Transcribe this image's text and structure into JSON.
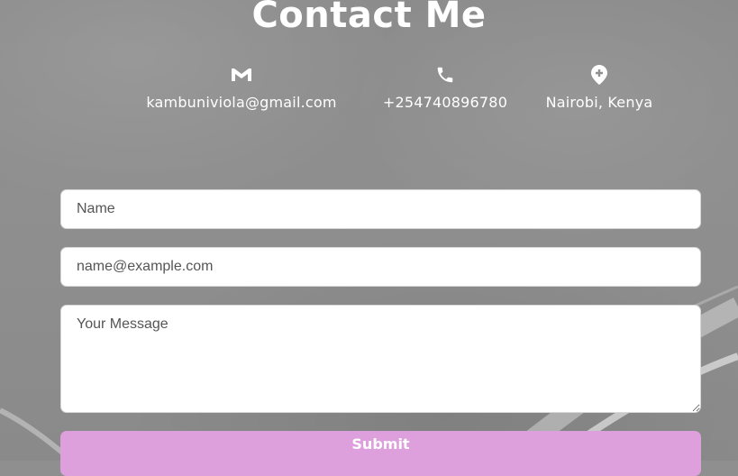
{
  "header": {
    "title": "Contact Me"
  },
  "contact_info": {
    "email": {
      "icon": "gmail-icon",
      "text": "kambuniviola@gmail.com"
    },
    "phone": {
      "icon": "phone-icon",
      "text": "+254740896780"
    },
    "location": {
      "icon": "map-pin-icon",
      "text": "Nairobi, Kenya"
    }
  },
  "form": {
    "name_placeholder": "Name",
    "email_placeholder": "name@example.com",
    "message_placeholder": "Your Message",
    "submit_label": "Submit"
  },
  "colors": {
    "background": "#8f8f8f",
    "text_light": "#ffffff",
    "submit_bg": "#dda0dd",
    "field_bg": "#ffffff"
  }
}
